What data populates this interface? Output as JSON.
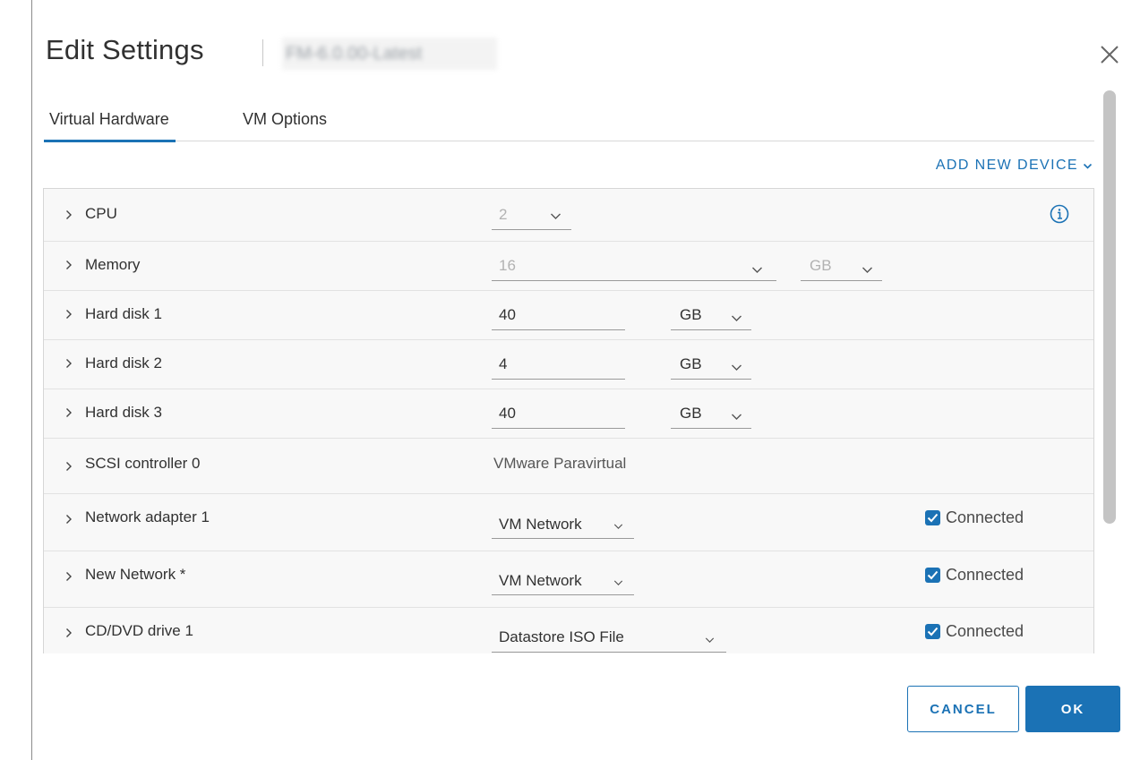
{
  "dialog": {
    "title": "Edit Settings",
    "vm_name": "FM-6.0.00-Latest"
  },
  "tabs": [
    {
      "label": "Virtual Hardware",
      "active": true
    },
    {
      "label": "VM Options",
      "active": false
    }
  ],
  "toolbar": {
    "add_device_label": "ADD NEW DEVICE"
  },
  "devices": {
    "cpu": {
      "label": "CPU",
      "value": "2"
    },
    "memory": {
      "label": "Memory",
      "value": "16",
      "unit": "GB"
    },
    "disk1": {
      "label": "Hard disk 1",
      "value": "40",
      "unit": "GB"
    },
    "disk2": {
      "label": "Hard disk 2",
      "value": "4",
      "unit": "GB"
    },
    "disk3": {
      "label": "Hard disk 3",
      "value": "40",
      "unit": "GB"
    },
    "scsi": {
      "label": "SCSI controller 0",
      "value": "VMware Paravirtual"
    },
    "net1": {
      "label": "Network adapter 1",
      "value": "VM Network",
      "status": "Connected",
      "checked": true
    },
    "net2": {
      "label": "New Network *",
      "value": "VM Network",
      "status": "Connected",
      "checked": true
    },
    "cd": {
      "label": "CD/DVD drive 1",
      "value": "Datastore ISO File",
      "status": "Connected",
      "checked": true
    }
  },
  "buttons": {
    "cancel": "CANCEL",
    "ok": "OK"
  },
  "colors": {
    "accent": "#1b72b5",
    "row_bg": "#f8f8f8",
    "disabled_text": "#b2b2b2"
  },
  "icons": [
    "close-icon",
    "info-icon",
    "chevron-right-icon",
    "chevron-down-icon",
    "checkbox-checked-icon"
  ]
}
